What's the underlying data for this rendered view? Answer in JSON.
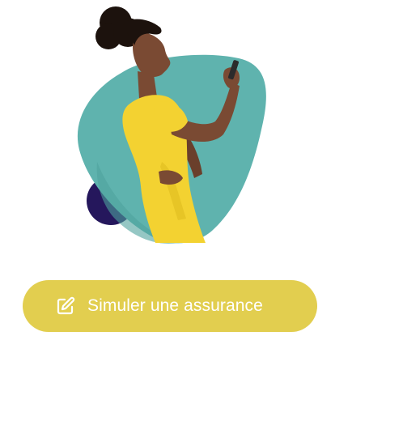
{
  "colors": {
    "teal_shape": "#5fb3ae",
    "teal_shade": "#4fa29d",
    "navy_circle": "#25175c",
    "dress_yellow": "#f3d231",
    "skin": "#7a4a33",
    "hair": "#1c120d",
    "button_bg": "#e2ce4f",
    "button_text": "#ffffff"
  },
  "hero": {
    "icons": [
      "woman-using-phone-illustration"
    ]
  },
  "cta": {
    "label": "Simuler une assurance",
    "icon": "edit-icon"
  }
}
